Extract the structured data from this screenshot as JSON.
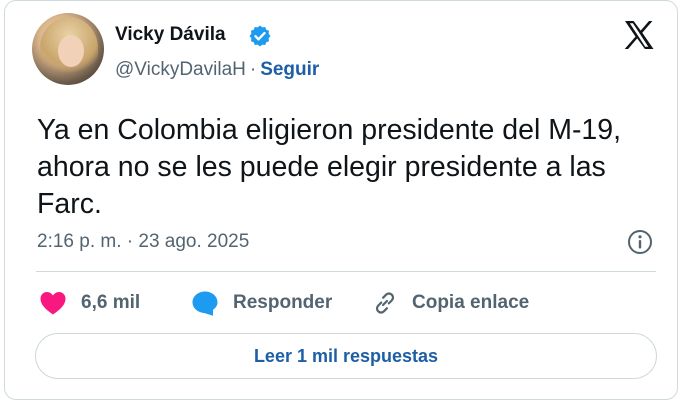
{
  "author": {
    "name": "Vicky Dávila",
    "handle": "@VickyDavilaH",
    "separator": "·",
    "follow_label": "Seguir",
    "verified_color": "#1d9bf0"
  },
  "tweet": {
    "text": "Ya en Colombia eligieron presidente del M-19, ahora no se les puede elegir presidente a las Farc.",
    "timestamp": "2:16 p. m. · 23 ago. 2025"
  },
  "actions": {
    "likes_count": "6,6 mil",
    "reply_label": "Responder",
    "copy_label": "Copia enlace"
  },
  "read_more": {
    "label": "Leer 1 mil respuestas"
  },
  "icons": [
    "verified-badge-icon",
    "x-logo-icon",
    "info-icon",
    "heart-icon",
    "reply-bubble-icon",
    "link-icon"
  ],
  "colors": {
    "accent": "#1d5fa6",
    "like": "#f91880",
    "reply": "#1d9bf0",
    "muted": "#536471"
  }
}
